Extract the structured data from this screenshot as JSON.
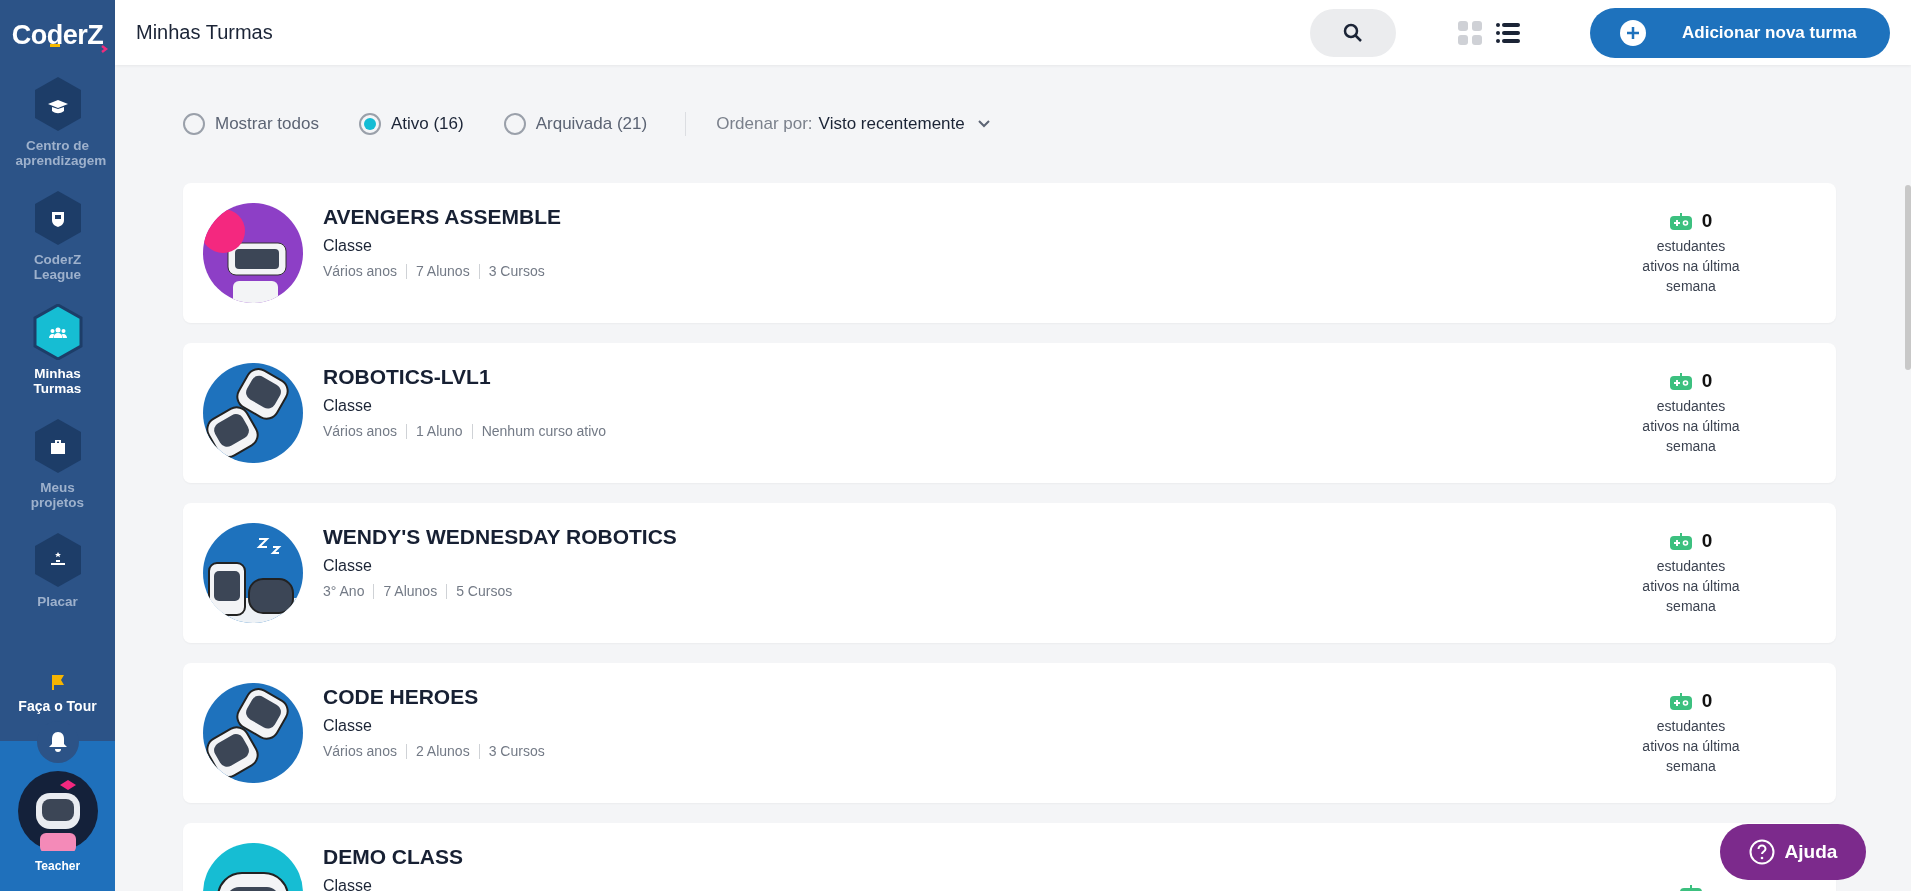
{
  "logo": {
    "text": "CoderZ"
  },
  "sidebar": {
    "items": [
      {
        "label": "Centro de aprendizagem",
        "kind": "cap",
        "selected": false
      },
      {
        "label": "CoderZ League",
        "kind": "shield",
        "selected": false
      },
      {
        "label": "Minhas Turmas",
        "kind": "people",
        "selected": true
      },
      {
        "label": "Meus projetos",
        "kind": "briefcase",
        "selected": false
      },
      {
        "label": "Placar",
        "kind": "podium",
        "selected": false
      }
    ],
    "tour": "Faça o Tour",
    "user": "Teacher"
  },
  "header": {
    "title": "Minhas Turmas",
    "views": [
      {
        "kind": "grid",
        "selected": false
      },
      {
        "kind": "list",
        "selected": true
      }
    ],
    "add_button": "Adicionar nova turma"
  },
  "filters": {
    "options": [
      {
        "label": "Mostrar todos",
        "selected": false
      },
      {
        "label": "Ativo (16)",
        "selected": true
      },
      {
        "label": "Arquivada (21)",
        "selected": false
      }
    ],
    "sort_label": "Ordenar por:",
    "sort_value": "Visto recentemente"
  },
  "classes": [
    {
      "name": "AVENGERS ASSEMBLE",
      "kind": "balloon",
      "type": "Classe",
      "meta": [
        "Vários anos",
        "7 Alunos",
        "3 Cursos"
      ],
      "active_count": "0",
      "active_label": "estudantes ativos na última semana"
    },
    {
      "name": "ROBOTICS-LVL1",
      "kind": "pair",
      "type": "Classe",
      "meta": [
        "Vários anos",
        "1 Aluno",
        "Nenhum curso ativo"
      ],
      "active_count": "0",
      "active_label": "estudantes ativos na última semana"
    },
    {
      "name": "WENDY'S WEDNESDAY ROBOTICS",
      "kind": "sleepy",
      "type": "Classe",
      "meta": [
        "3° Ano",
        "7 Alunos",
        "5 Cursos"
      ],
      "active_count": "0",
      "active_label": "estudantes ativos na última semana"
    },
    {
      "name": "CODE HEROES",
      "kind": "pair",
      "type": "Classe",
      "meta": [
        "Vários anos",
        "2 Alunos",
        "3 Cursos"
      ],
      "active_count": "0",
      "active_label": "estudantes ativos na última semana"
    },
    {
      "name": "DEMO CLASS",
      "kind": "peek",
      "type": "Classe"
    }
  ],
  "help_button": "Ajuda"
}
